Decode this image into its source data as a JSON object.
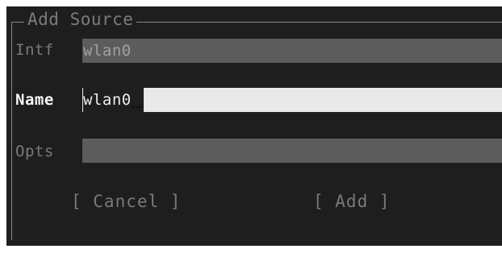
{
  "dialog": {
    "title": "Add Source"
  },
  "fields": [
    {
      "label": "Intf",
      "value": "wlan0",
      "active": false
    },
    {
      "label": "Name",
      "value": "wlan0",
      "active": true
    },
    {
      "label": "Opts",
      "value": "",
      "active": false
    }
  ],
  "buttons": {
    "cancel_label": "[ Cancel ]",
    "add_label": "[ Add ]"
  },
  "colors": {
    "background": "#1e1e1e",
    "field_inactive": "#5c5c5c",
    "field_active": "#e9e9e9",
    "label_inactive": "#7a7a7a",
    "label_active": "#f4f4f4"
  }
}
